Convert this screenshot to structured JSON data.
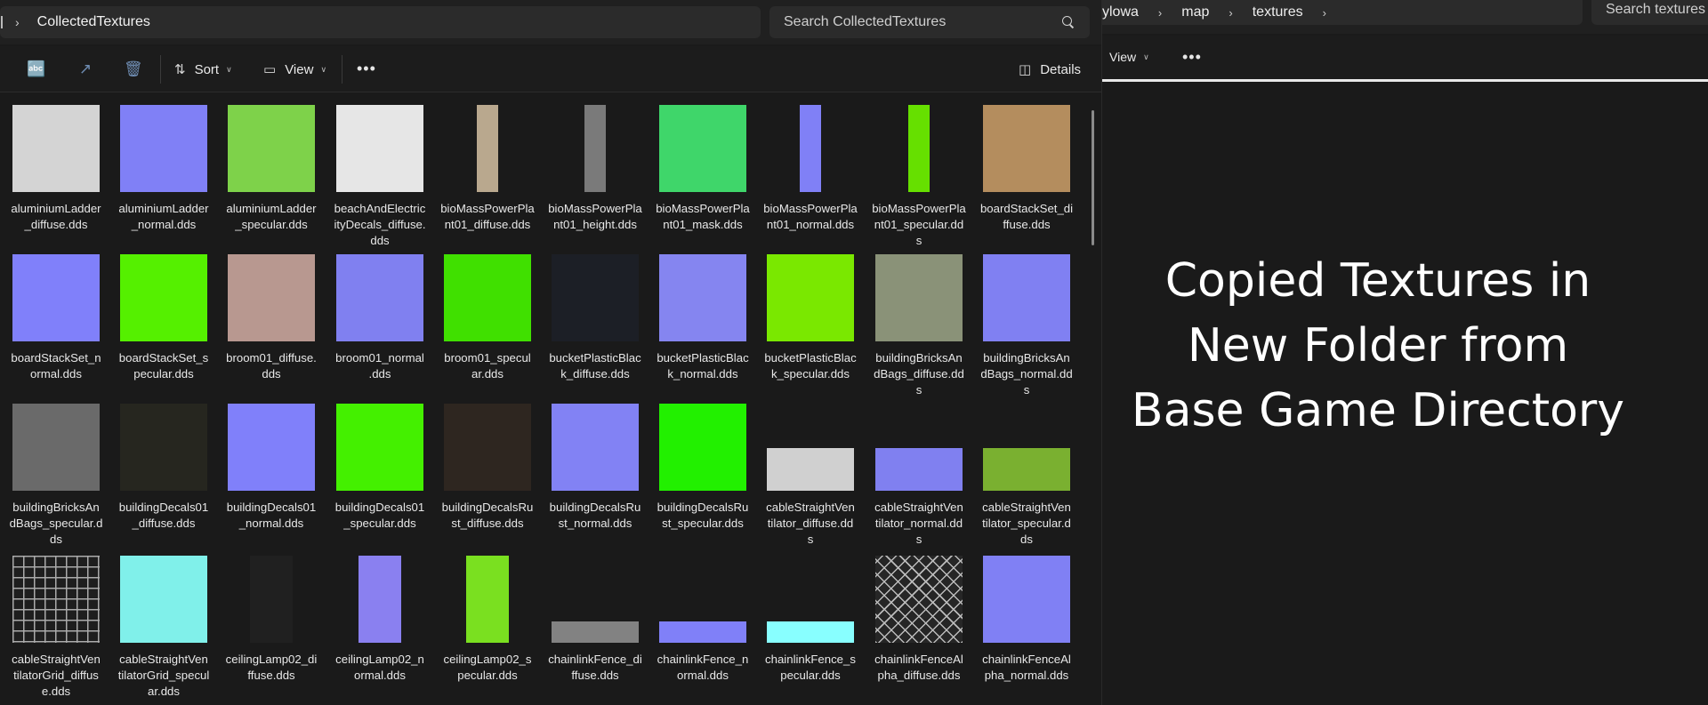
{
  "left_window": {
    "breadcrumb": "CollectedTextures",
    "search_placeholder": "Search CollectedTextures",
    "toolbar": {
      "sort_label": "Sort",
      "view_label": "View",
      "details_label": "Details"
    },
    "files": [
      {
        "name": "aluminiumLadder_diffuse.dds",
        "lines": [
          "aluminiumLadder",
          "_diffuse.dds"
        ],
        "color": "#d4d4d4",
        "shape": "square"
      },
      {
        "name": "aluminiumLadder_normal.dds",
        "lines": [
          "aluminiumLadder",
          "_normal.dds"
        ],
        "color": "#8080f6",
        "shape": "square"
      },
      {
        "name": "aluminiumLadder_specular.dds",
        "lines": [
          "aluminiumLadder",
          "_specular.dds"
        ],
        "color": "#7ed24a",
        "shape": "square"
      },
      {
        "name": "beachAndElectricityDecals_diffuse.dds",
        "lines": [
          "beachAndElectric",
          "ityDecals_diffuse.",
          "dds"
        ],
        "color": "#e6e6e6",
        "shape": "square"
      },
      {
        "name": "bioMassPowerPlant01_diffuse.dds",
        "lines": [
          "bioMassPowerPla",
          "nt01_diffuse.dds"
        ],
        "color": "#b9a88e",
        "shape": "strip"
      },
      {
        "name": "bioMassPowerPlant01_height.dds",
        "lines": [
          "bioMassPowerPla",
          "nt01_height.dds"
        ],
        "color": "#7a7a7a",
        "shape": "strip"
      },
      {
        "name": "bioMassPowerPlant01_mask.dds",
        "lines": [
          "bioMassPowerPla",
          "nt01_mask.dds"
        ],
        "color": "#3fd66a",
        "shape": "square"
      },
      {
        "name": "bioMassPowerPlant01_normal.dds",
        "lines": [
          "bioMassPowerPla",
          "nt01_normal.dds"
        ],
        "color": "#8080f6",
        "shape": "strip"
      },
      {
        "name": "bioMassPowerPlant01_specular.dds",
        "lines": [
          "bioMassPowerPla",
          "nt01_specular.dd",
          "s"
        ],
        "color": "#66e000",
        "shape": "strip"
      },
      {
        "name": "boardStackSet_diffuse.dds",
        "lines": [
          "boardStackSet_di",
          "ffuse.dds"
        ],
        "color": "#b48d5e",
        "shape": "square"
      },
      {
        "name": "boardStackSet_normal.dds",
        "lines": [
          "boardStackSet_n",
          "ormal.dds"
        ],
        "color": "#8080fa",
        "shape": "square"
      },
      {
        "name": "boardStackSet_specular.dds",
        "lines": [
          "boardStackSet_s",
          "pecular.dds"
        ],
        "color": "#55f000",
        "shape": "square"
      },
      {
        "name": "broom01_diffuse.dds",
        "lines": [
          "broom01_diffuse.",
          "dds"
        ],
        "color": "#b89890",
        "shape": "square"
      },
      {
        "name": "broom01_normal.dds",
        "lines": [
          "broom01_normal",
          ".dds"
        ],
        "color": "#8080f0",
        "shape": "square"
      },
      {
        "name": "broom01_specular.dds",
        "lines": [
          "broom01_specul",
          "ar.dds"
        ],
        "color": "#40e000",
        "shape": "square"
      },
      {
        "name": "bucketPlasticBlack_diffuse.dds",
        "lines": [
          "bucketPlasticBlac",
          "k_diffuse.dds"
        ],
        "color": "#1c1f26",
        "shape": "square"
      },
      {
        "name": "bucketPlasticBlack_normal.dds",
        "lines": [
          "bucketPlasticBlac",
          "k_normal.dds"
        ],
        "color": "#8585f0",
        "shape": "square"
      },
      {
        "name": "bucketPlasticBlack_specular.dds",
        "lines": [
          "bucketPlasticBlac",
          "k_specular.dds"
        ],
        "color": "#7ae800",
        "shape": "square"
      },
      {
        "name": "buildingBricksAndBags_diffuse.dds",
        "lines": [
          "buildingBricksAn",
          "dBags_diffuse.dd",
          "s"
        ],
        "color": "#8a9278",
        "shape": "square"
      },
      {
        "name": "buildingBricksAndBags_normal.dds",
        "lines": [
          "buildingBricksAn",
          "dBags_normal.dd",
          "s"
        ],
        "color": "#8080f2",
        "shape": "square"
      },
      {
        "name": "buildingBricksAndBags_specular.dds",
        "lines": [
          "buildingBricksAn",
          "dBags_specular.d",
          "ds"
        ],
        "color": "#6a6a6a",
        "shape": "square"
      },
      {
        "name": "buildingDecals01_diffuse.dds",
        "lines": [
          "buildingDecals01",
          "_diffuse.dds"
        ],
        "color": "#26261f",
        "shape": "square"
      },
      {
        "name": "buildingDecals01_normal.dds",
        "lines": [
          "buildingDecals01",
          "_normal.dds"
        ],
        "color": "#8080fa",
        "shape": "square"
      },
      {
        "name": "buildingDecals01_specular.dds",
        "lines": [
          "buildingDecals01",
          "_specular.dds"
        ],
        "color": "#44f000",
        "shape": "square"
      },
      {
        "name": "buildingDecalsRust_diffuse.dds",
        "lines": [
          "buildingDecalsRu",
          "st_diffuse.dds"
        ],
        "color": "#2e2620",
        "shape": "square"
      },
      {
        "name": "buildingDecalsRust_normal.dds",
        "lines": [
          "buildingDecalsRu",
          "st_normal.dds"
        ],
        "color": "#8282f4",
        "shape": "square"
      },
      {
        "name": "buildingDecalsRust_specular.dds",
        "lines": [
          "buildingDecalsRu",
          "st_specular.dds"
        ],
        "color": "#22f000",
        "shape": "square"
      },
      {
        "name": "cableStraightVentilator_diffuse.dds",
        "lines": [
          "cableStraightVen",
          "tilator_diffuse.dd",
          "s"
        ],
        "color": "#d0d0d0",
        "shape": "wide"
      },
      {
        "name": "cableStraightVentilator_normal.dds",
        "lines": [
          "cableStraightVen",
          "tilator_normal.dd",
          "s"
        ],
        "color": "#8080f0",
        "shape": "wide"
      },
      {
        "name": "cableStraightVentilator_specular.dds",
        "lines": [
          "cableStraightVen",
          "tilator_specular.d",
          "ds"
        ],
        "color": "#7ab030",
        "shape": "wide"
      },
      {
        "name": "cableStraightVentilatorGrid_diffuse.dds",
        "lines": [
          "cableStraightVen",
          "tilatorGrid_diffus",
          "e.dds"
        ],
        "color": "#1e1e1e",
        "shape": "grid"
      },
      {
        "name": "cableStraightVentilatorGrid_specular.dds",
        "lines": [
          "cableStraightVen",
          "tilatorGrid_specul",
          "ar.dds"
        ],
        "color": "#80f0ea",
        "shape": "square"
      },
      {
        "name": "ceilingLamp02_diffuse.dds",
        "lines": [
          "ceilingLamp02_di",
          "ffuse.dds"
        ],
        "color": "#202020",
        "shape": "tall"
      },
      {
        "name": "ceilingLamp02_normal.dds",
        "lines": [
          "ceilingLamp02_n",
          "ormal.dds"
        ],
        "color": "#8a80f0",
        "shape": "tall"
      },
      {
        "name": "ceilingLamp02_specular.dds",
        "lines": [
          "ceilingLamp02_s",
          "pecular.dds"
        ],
        "color": "#7ae020",
        "shape": "tall"
      },
      {
        "name": "chainlinkFence_diffuse.dds",
        "lines": [
          "chainlinkFence_di",
          "ffuse.dds"
        ],
        "color": "#828282",
        "shape": "flat"
      },
      {
        "name": "chainlinkFence_normal.dds",
        "lines": [
          "chainlinkFence_n",
          "ormal.dds"
        ],
        "color": "#8080f8",
        "shape": "flat"
      },
      {
        "name": "chainlinkFence_specular.dds",
        "lines": [
          "chainlinkFence_s",
          "pecular.dds"
        ],
        "color": "#88ffff",
        "shape": "flat"
      },
      {
        "name": "chainlinkFenceAlpha_diffuse.dds",
        "lines": [
          "chainlinkFenceAl",
          "pha_diffuse.dds"
        ],
        "color": "#262626",
        "shape": "mesh"
      },
      {
        "name": "chainlinkFenceAlpha_normal.dds",
        "lines": [
          "chainlinkFenceAl",
          "pha_normal.dds"
        ],
        "color": "#8080f4",
        "shape": "square"
      }
    ]
  },
  "right_window": {
    "breadcrumbs": [
      "ylowa",
      "map",
      "textures"
    ],
    "search_placeholder": "Search textures",
    "toolbar": {
      "view_label": "View"
    },
    "caption_lines": [
      "Copied Textures in",
      "New Folder from",
      "Base Game Directory"
    ]
  }
}
